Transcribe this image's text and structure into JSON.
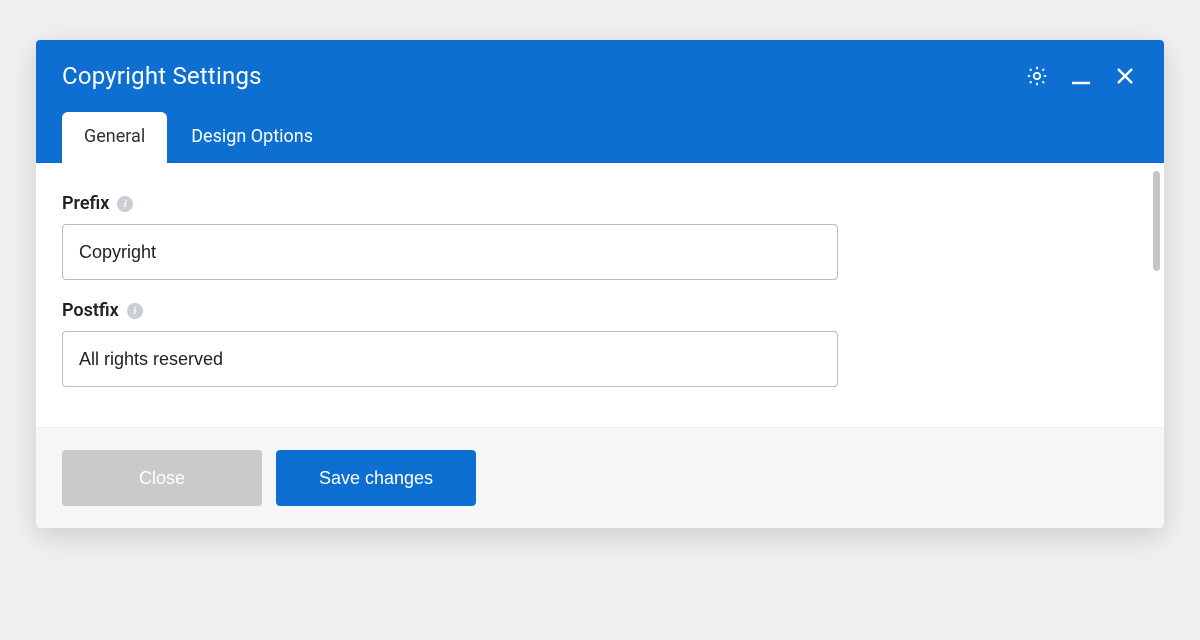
{
  "modal": {
    "title": "Copyright Settings"
  },
  "tabs": {
    "general": "General",
    "design_options": "Design Options"
  },
  "fields": {
    "prefix": {
      "label": "Prefix",
      "value": "Copyright"
    },
    "postfix": {
      "label": "Postfix",
      "value": "All rights reserved"
    }
  },
  "footer": {
    "close": "Close",
    "save": "Save changes"
  },
  "icons": {
    "info_glyph": "i"
  }
}
